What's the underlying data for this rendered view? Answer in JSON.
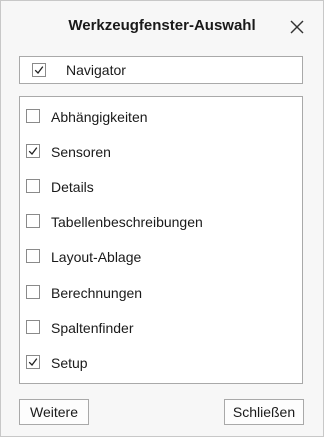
{
  "dialog": {
    "title": "Werkzeugfenster-Auswahl",
    "close_icon": "close-x-icon"
  },
  "navigator": {
    "label": "Navigator",
    "checked": true
  },
  "tools": [
    {
      "label": "Abhängigkeiten",
      "checked": false
    },
    {
      "label": "Sensoren",
      "checked": true
    },
    {
      "label": "Details",
      "checked": false
    },
    {
      "label": "Tabellenbeschreibungen",
      "checked": false
    },
    {
      "label": "Layout-Ablage",
      "checked": false
    },
    {
      "label": "Berechnungen",
      "checked": false
    },
    {
      "label": "Spaltenfinder",
      "checked": false
    },
    {
      "label": "Setup",
      "checked": true
    }
  ],
  "buttons": {
    "more_label": "Weitere",
    "close_label": "Schließen"
  }
}
